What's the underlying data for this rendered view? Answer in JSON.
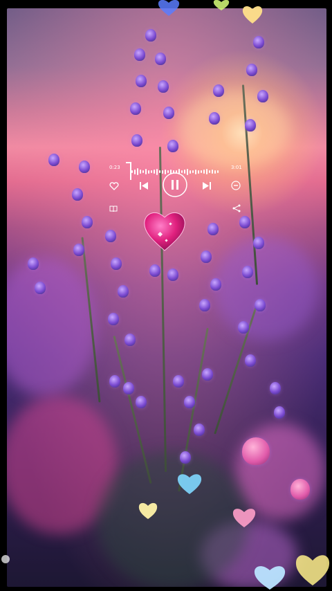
{
  "player": {
    "elapsed": "0:23",
    "duration": "3:01",
    "icons": {
      "like": "heart-outline-icon",
      "previous": "skip-previous-icon",
      "play_pause": "pause-icon",
      "next": "skip-next-icon",
      "remove": "minus-circle-icon",
      "lyrics": "book-icon",
      "share": "share-icon"
    }
  },
  "decor": {
    "center_heart_color": "#e0207e",
    "bokeh_colors": [
      "#ffe08a",
      "#7fd8ff",
      "#ff9fc9",
      "#fff2a8",
      "#b9e4ff"
    ]
  }
}
